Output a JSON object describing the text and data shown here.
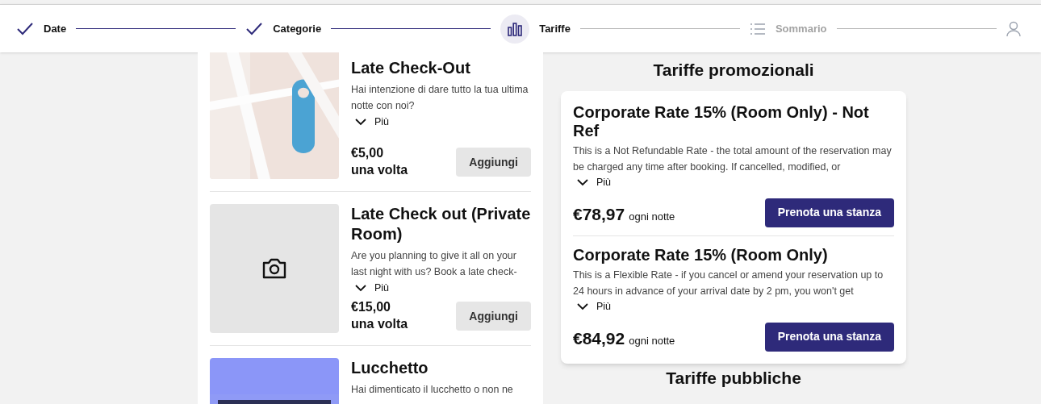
{
  "steps": [
    {
      "label": "Date",
      "done": true,
      "selected": false
    },
    {
      "label": "Categorie",
      "done": true,
      "selected": false
    },
    {
      "label": "Tariffe",
      "done": false,
      "selected": true
    },
    {
      "label": "Sommario",
      "done": false,
      "selected": false
    }
  ],
  "extras": [
    {
      "title": "Late Check-Out",
      "description": "Hai intenzione di dare tutto la tua ultima notte con noi?",
      "more": "Più",
      "price": "€5,00",
      "frequency": "una volta",
      "button": "Aggiungi"
    },
    {
      "kind": "placeholder",
      "title": "Late Check out (Private Room)",
      "description": "Are you planning to give it all on your last night with us? Book a late check-",
      "more": "Più",
      "price": "€15,00",
      "frequency": "una volta",
      "button": "Aggiungi"
    },
    {
      "title": "Lucchetto",
      "description": "Hai dimenticato il lucchetto o non ne"
    }
  ],
  "promo": {
    "heading": "Tariffe promozionali",
    "rates": [
      {
        "name": "Corporate Rate 15% (Room Only) - Not Ref",
        "description": "This is a Not Refundable Rate - the total amount of the reservation may be charged any time after booking. If cancelled, modified, or",
        "more": "Più",
        "price": "€78,97",
        "per": "ogni notte",
        "button": "Prenota una stanza"
      },
      {
        "name": "Corporate Rate 15% (Room Only)",
        "description": "This is a Flexible Rate - if you cancel or amend your reservation up to 24 hours in advance of your arrival date by 2 pm, you won't get",
        "more": "Più",
        "price": "€84,92",
        "per": "ogni notte",
        "button": "Prenota una stanza"
      }
    ]
  },
  "public": {
    "heading": "Tariffe pubbliche"
  }
}
